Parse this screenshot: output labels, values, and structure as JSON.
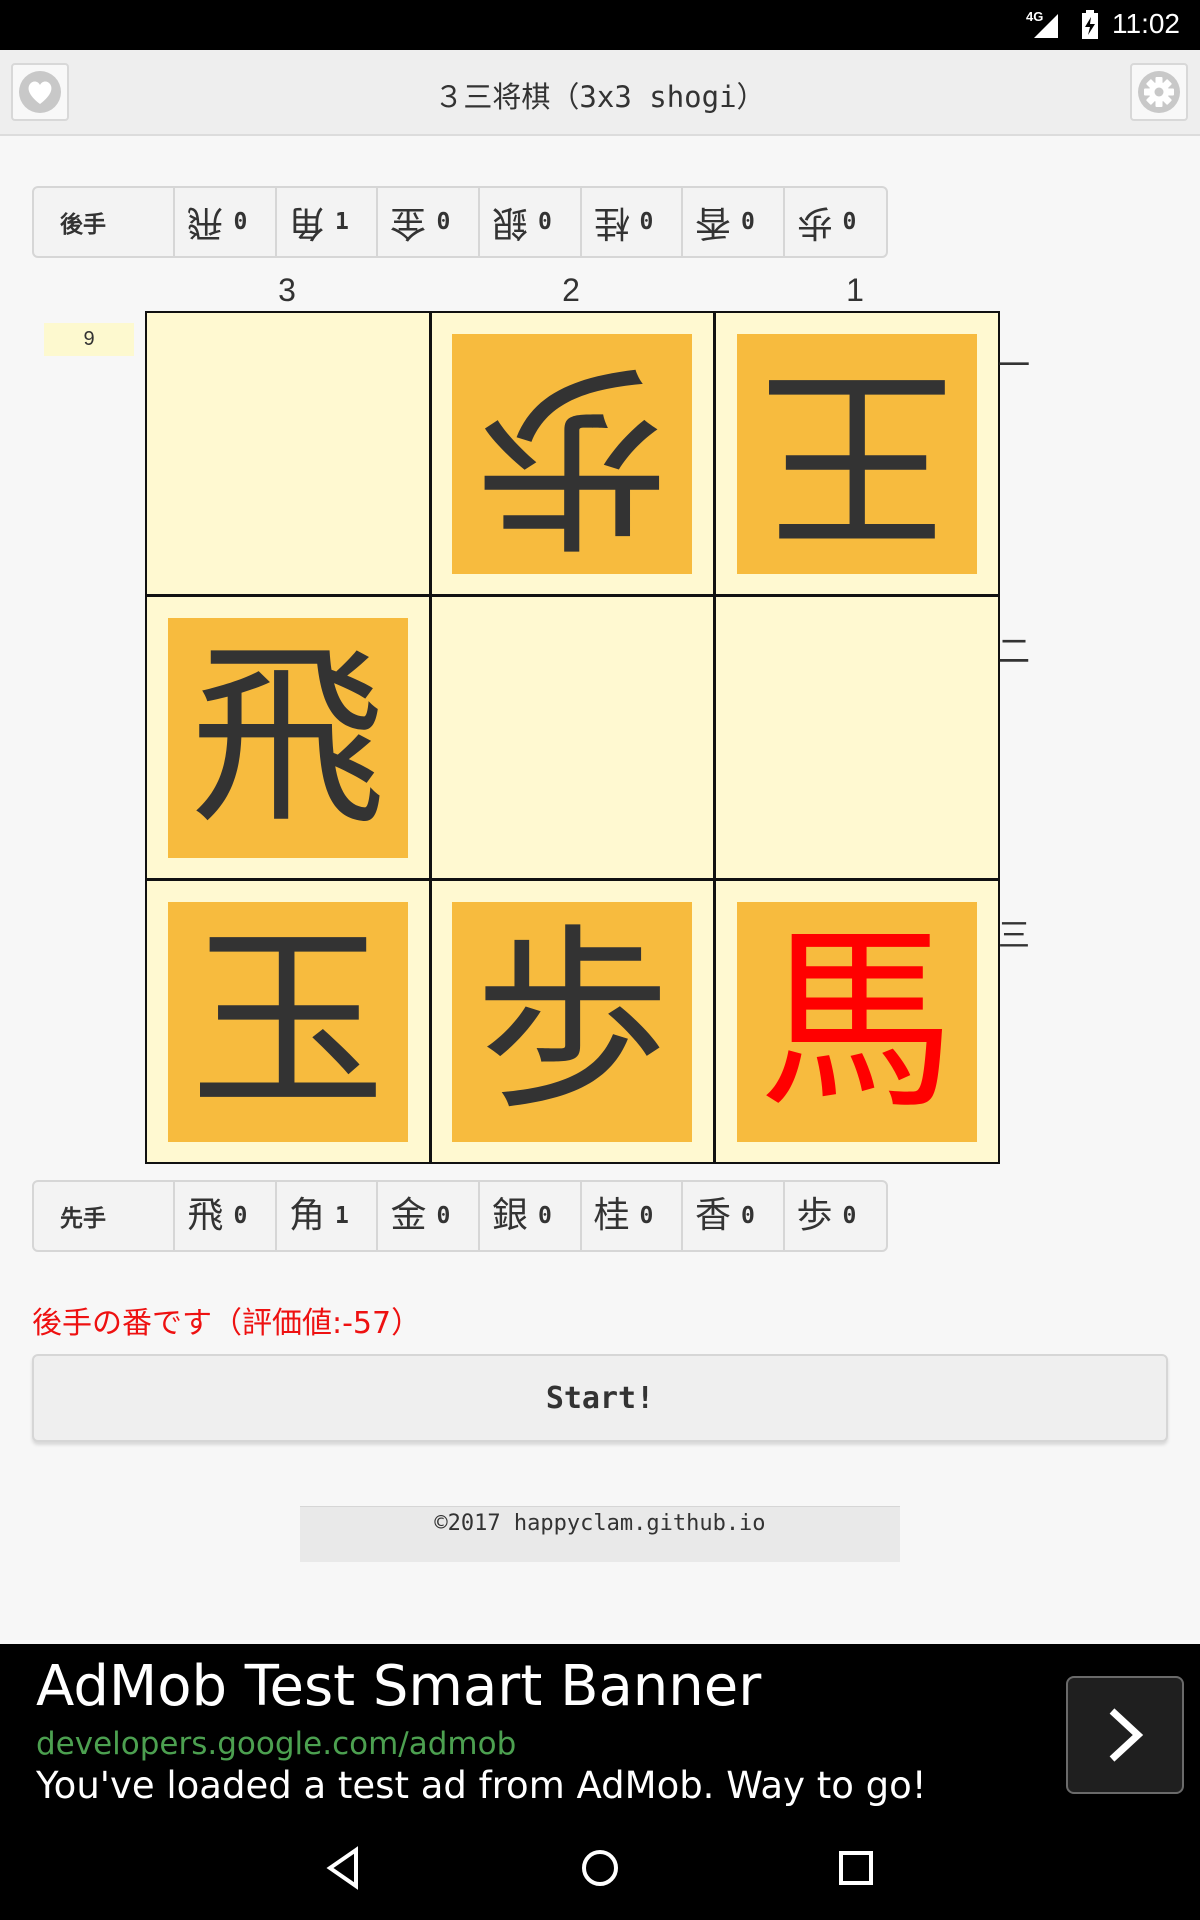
{
  "status_bar": {
    "network": "4G",
    "time": "11:02"
  },
  "header": {
    "title": "３三将棋（3x3 shogi）",
    "left_icon": "heart-icon",
    "right_icon": "gear-icon"
  },
  "gote_hand": {
    "owner": "後手",
    "pieces": [
      {
        "kanji": "飛",
        "count": "0"
      },
      {
        "kanji": "角",
        "count": "1"
      },
      {
        "kanji": "金",
        "count": "0"
      },
      {
        "kanji": "銀",
        "count": "0"
      },
      {
        "kanji": "桂",
        "count": "0"
      },
      {
        "kanji": "香",
        "count": "0"
      },
      {
        "kanji": "歩",
        "count": "0"
      }
    ]
  },
  "sente_hand": {
    "owner": "先手",
    "pieces": [
      {
        "kanji": "飛",
        "count": "0"
      },
      {
        "kanji": "角",
        "count": "1"
      },
      {
        "kanji": "金",
        "count": "0"
      },
      {
        "kanji": "銀",
        "count": "0"
      },
      {
        "kanji": "桂",
        "count": "0"
      },
      {
        "kanji": "香",
        "count": "0"
      },
      {
        "kanji": "歩",
        "count": "0"
      }
    ]
  },
  "board": {
    "move_count": "9",
    "files": [
      "3",
      "2",
      "1"
    ],
    "ranks": [
      "一",
      "二",
      "三"
    ],
    "squares": [
      {
        "piece": "",
        "owner": ""
      },
      {
        "piece": "歩",
        "owner": "gote"
      },
      {
        "piece": "王",
        "owner": "gote"
      },
      {
        "piece": "飛",
        "owner": "sente"
      },
      {
        "piece": "",
        "owner": ""
      },
      {
        "piece": "",
        "owner": ""
      },
      {
        "piece": "玉",
        "owner": "sente"
      },
      {
        "piece": "歩",
        "owner": "sente"
      },
      {
        "piece": "馬",
        "owner": "sente",
        "promoted": true
      }
    ],
    "piece_color": "#f7bb3e",
    "square_color": "#fff9d1",
    "promoted_color": "#ff0000"
  },
  "turn_message": "後手の番です（評価値:-57）",
  "start_button": "Start!",
  "footer": "©2017 happyclam.github.io",
  "ad": {
    "title": "AdMob Test Smart Banner",
    "url": "developers.google.com/admob",
    "text": "You've loaded a test ad from AdMob. Way to go!"
  }
}
